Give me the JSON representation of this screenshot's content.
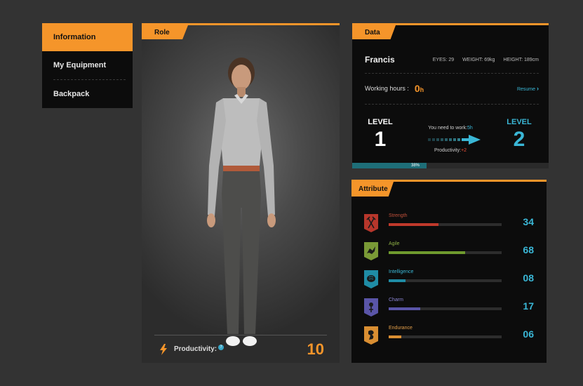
{
  "menu": {
    "items": [
      {
        "label": "Information",
        "active": true
      },
      {
        "label": "My Equipment",
        "active": false
      },
      {
        "label": "Backpack",
        "active": false
      }
    ]
  },
  "role": {
    "tab_label": "Role",
    "productivity_label": "Productivity:",
    "productivity_value": "10",
    "icon": "lightning-bolt-icon"
  },
  "data_panel": {
    "tab_label": "Data",
    "name": "Francis",
    "eyes": "EYES: 29",
    "weight": "WEIGHT: 69kg",
    "height": "HEIGHT: 189cm",
    "working_hours_label": "Working hours :",
    "working_hours_value": "0",
    "working_hours_unit": "h",
    "resume_label": "Resume",
    "level_label": "LEVEL",
    "level_current": "1",
    "level_next": "2",
    "need_prefix": "You need to work:",
    "need_value": "5h",
    "productivity_prefix": "Productivity:",
    "productivity_bonus": "+2",
    "progress_text": "38%",
    "progress": 0.38
  },
  "attributes": {
    "tab_label": "Attribute",
    "items": [
      {
        "name": "Strength",
        "value": "34",
        "level": 0.44,
        "color": "#c0392b",
        "name_color": "#c0503a",
        "icon": "strength-shield-icon"
      },
      {
        "name": "Agile",
        "value": "68",
        "level": 0.68,
        "color": "#6f9a2e",
        "name_color": "#8fb246",
        "icon": "agile-shield-icon"
      },
      {
        "name": "Intelligence",
        "value": "08",
        "level": 0.15,
        "color": "#1f8ca5",
        "name_color": "#3ab7d6",
        "icon": "intelligence-shield-icon"
      },
      {
        "name": "Charm",
        "value": "17",
        "level": 0.28,
        "color": "#5a55a8",
        "name_color": "#8a84d2",
        "icon": "charm-shield-icon"
      },
      {
        "name": "Endurance",
        "value": "06",
        "level": 0.11,
        "color": "#d98e32",
        "name_color": "#e5a04a",
        "icon": "endurance-shield-icon"
      }
    ]
  },
  "colors": {
    "accent": "#f5952a",
    "cyan": "#3ab7d6",
    "panel": "#0c0c0c",
    "background": "#333333"
  }
}
